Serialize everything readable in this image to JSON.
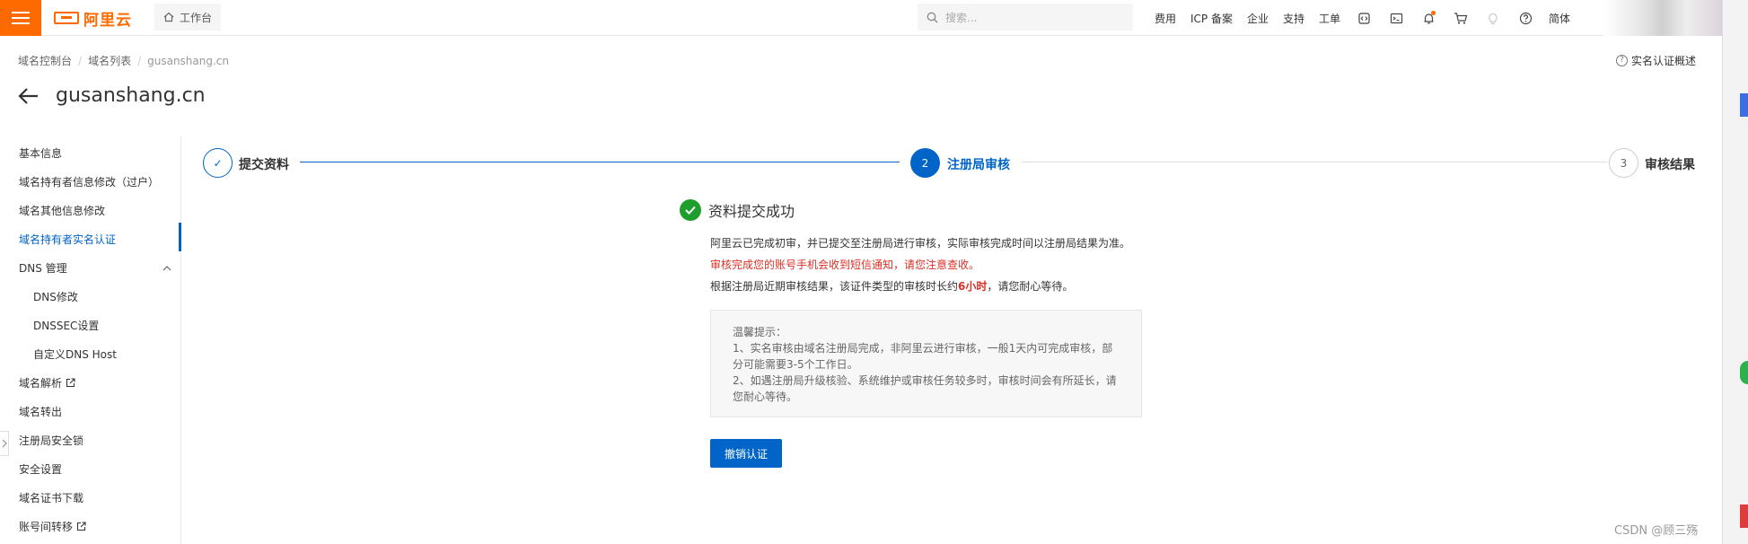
{
  "topbar": {
    "logo_text": "阿里云",
    "workbench": "工作台",
    "search_placeholder": "搜索...",
    "links": [
      "费用",
      "ICP 备案",
      "企业",
      "支持",
      "工单"
    ],
    "lang": "简体",
    "icons": [
      "code-icon",
      "terminal-icon",
      "bell-icon",
      "cart-icon",
      "lightbulb-icon",
      "help-icon"
    ]
  },
  "breadcrumb": [
    "域名控制台",
    "域名列表",
    "gusanshang.cn"
  ],
  "help_link": "实名认证概述",
  "page_title": "gusanshang.cn",
  "sidebar": {
    "items": [
      {
        "label": "基本信息"
      },
      {
        "label": "域名持有者信息修改（过户）"
      },
      {
        "label": "域名其他信息修改"
      },
      {
        "label": "域名持有者实名认证",
        "active": true
      },
      {
        "label": "DNS 管理",
        "expanded": true
      },
      {
        "label": "DNS修改",
        "sub": true
      },
      {
        "label": "DNSSEC设置",
        "sub": true
      },
      {
        "label": "自定义DNS Host",
        "sub": true
      },
      {
        "label": "域名解析",
        "external": true
      },
      {
        "label": "域名转出"
      },
      {
        "label": "注册局安全锁"
      },
      {
        "label": "安全设置"
      },
      {
        "label": "域名证书下载"
      },
      {
        "label": "账号间转移",
        "external": true
      }
    ]
  },
  "steps": [
    {
      "label": "提交资料",
      "state": "done",
      "mark": "✓"
    },
    {
      "label": "注册局审核",
      "state": "active",
      "mark": "2"
    },
    {
      "label": "审核结果",
      "state": "pending",
      "mark": "3"
    }
  ],
  "result": {
    "title": "资料提交成功",
    "line1": "阿里云已完成初审，并已提交至注册局进行审核，实际审核完成时间以注册局结果为准。",
    "line2": "审核完成您的账号手机会收到短信通知，请您注意查收。",
    "line3_prefix": "根据注册局近期审核结果，该证件类型的审核时长约",
    "line3_highlight": "6小时",
    "line3_suffix": "，请您耐心等待。",
    "tips_title": "温馨提示：",
    "tip1": "1、实名审核由域名注册局完成，非阿里云进行审核，一般1天内可完成审核，部分可能需要3-5个工作日。",
    "tip2": "2、如遇注册局升级核验、系统维护或审核任务较多时，审核时间会有所延长，请您耐心等待。",
    "cancel_button": "撤销认证"
  },
  "watermark": "CSDN @顾三殇",
  "colors": {
    "brand": "#ff6a00",
    "primary": "#0064c8",
    "success": "#1e9e2c",
    "danger": "#d93026"
  }
}
